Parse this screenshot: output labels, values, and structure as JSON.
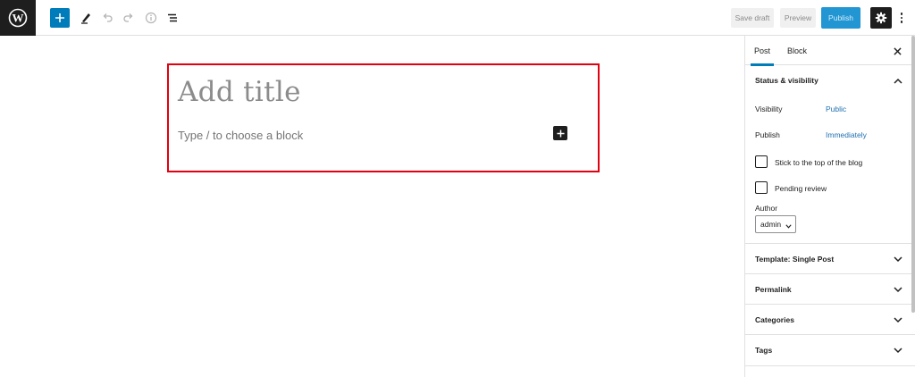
{
  "toolbar": {
    "save_draft_label": "Save draft",
    "preview_label": "Preview",
    "publish_label": "Publish",
    "icons": [
      "wordpress-logo",
      "add-block-icon",
      "tools-pen-icon",
      "undo-icon",
      "redo-icon",
      "details-info-icon",
      "list-view-icon",
      "settings-gear-icon",
      "more-options-icon"
    ],
    "colors": {
      "add_button": "#007cba",
      "publish_button": "#2196d3",
      "dark": "#1e1e1e"
    }
  },
  "editor": {
    "title_placeholder": "Add title",
    "block_placeholder": "Type / to choose a block",
    "highlight_color": "#e3000f"
  },
  "sidebar": {
    "tabs": [
      {
        "label": "Post",
        "active": true
      },
      {
        "label": "Block",
        "active": false
      }
    ],
    "status_section": {
      "title": "Status & visibility",
      "expanded": true,
      "visibility_label": "Visibility",
      "visibility_value": "Public",
      "publish_label": "Publish",
      "publish_value": "Immediately",
      "sticky_label": "Stick to the top of the blog",
      "sticky_checked": false,
      "pending_label": "Pending review",
      "pending_checked": false,
      "author_label": "Author",
      "author_value": "admin"
    },
    "sections": [
      {
        "title": "Template: Single Post"
      },
      {
        "title": "Permalink"
      },
      {
        "title": "Categories"
      },
      {
        "title": "Tags"
      }
    ]
  }
}
